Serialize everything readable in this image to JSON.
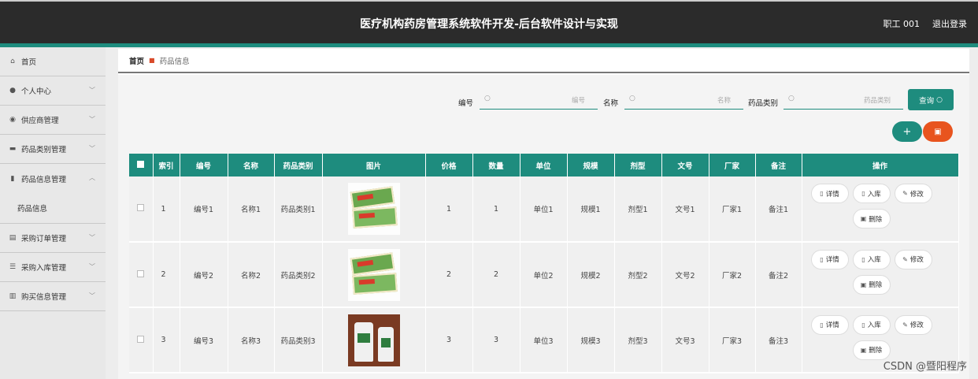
{
  "header": {
    "title": "医疗机构药房管理系统软件开发-后台软件设计与实现",
    "user": "职工 001",
    "logout": "退出登录"
  },
  "sidebar": {
    "items": [
      {
        "label": "首页",
        "icon": "home-icon"
      },
      {
        "label": "个人中心",
        "icon": "user-icon"
      },
      {
        "label": "供应商管理",
        "icon": "location-icon"
      },
      {
        "label": "药品类别管理",
        "icon": "card-icon"
      },
      {
        "label": "药品信息管理",
        "icon": "bar-chart-icon"
      },
      {
        "label": "药品信息",
        "icon": ""
      },
      {
        "label": "采购订单管理",
        "icon": "ticket-icon"
      },
      {
        "label": "采购入库管理",
        "icon": "list-icon"
      },
      {
        "label": "购买信息管理",
        "icon": "document-icon"
      }
    ]
  },
  "breadcrumb": {
    "home": "首页",
    "current": "药品信息"
  },
  "search": {
    "code_label": "编号",
    "code_placeholder": "编号",
    "name_label": "名称",
    "name_placeholder": "名称",
    "category_label": "药品类别",
    "category_placeholder": "药品类别",
    "query_button": "查询"
  },
  "table": {
    "headers": [
      "索引",
      "编号",
      "名称",
      "药品类别",
      "图片",
      "价格",
      "数量",
      "单位",
      "规模",
      "剂型",
      "文号",
      "厂家",
      "备注",
      "操作"
    ],
    "rows": [
      {
        "index": "1",
        "code": "编号1",
        "name": "名称1",
        "category": "药品类别1",
        "image": "medicine-boxes",
        "price": "1",
        "qty": "1",
        "unit": "单位1",
        "scale": "规模1",
        "form": "剂型1",
        "doc": "文号1",
        "maker": "厂家1",
        "note": "备注1"
      },
      {
        "index": "2",
        "code": "编号2",
        "name": "名称2",
        "category": "药品类别2",
        "image": "medicine-boxes",
        "price": "2",
        "qty": "2",
        "unit": "单位2",
        "scale": "规模2",
        "form": "剂型2",
        "doc": "文号2",
        "maker": "厂家2",
        "note": "备注2"
      },
      {
        "index": "3",
        "code": "编号3",
        "name": "名称3",
        "category": "药品类别3",
        "image": "medicine-bottles",
        "price": "3",
        "qty": "3",
        "unit": "单位3",
        "scale": "规模3",
        "form": "剂型3",
        "doc": "文号3",
        "maker": "厂家3",
        "note": "备注3"
      }
    ],
    "actions": {
      "detail": "详情",
      "stock_in": "入库",
      "edit": "修改",
      "delete": "删除"
    }
  },
  "watermark": "CSDN @暨阳程序"
}
